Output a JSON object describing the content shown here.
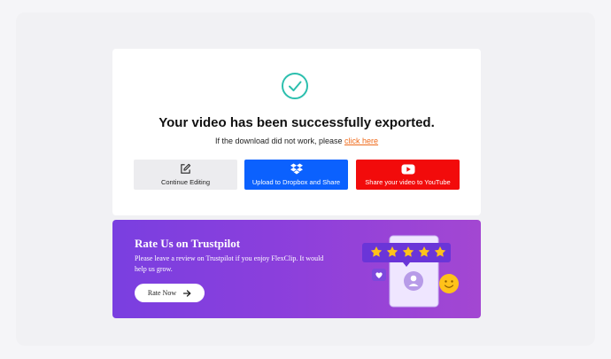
{
  "success": {
    "title": "Your video has been successfully exported.",
    "subtitle_prefix": "If the download did not work, please ",
    "subtitle_link": "click here"
  },
  "actions": [
    {
      "label": "Continue Editing",
      "icon": "edit-icon",
      "color": "#ececef"
    },
    {
      "label": "Upload to Dropbox and Share",
      "icon": "dropbox-icon",
      "color": "#0b61fe"
    },
    {
      "label": "Share your video to YouTube",
      "icon": "youtube-icon",
      "color": "#f20b0b"
    }
  ],
  "banner": {
    "title": "Rate Us on Trustpilot",
    "text": "Please leave a review on Trustpilot if you enjoy FlexClip. It would help us grow.",
    "button_label": "Rate Now",
    "stars": 5,
    "gradient_start": "#7a3fe0",
    "gradient_end": "#a347d2"
  },
  "colors": {
    "accent_check": "#2cbfae",
    "link": "#ef6a1a",
    "star": "#ffc21a"
  }
}
